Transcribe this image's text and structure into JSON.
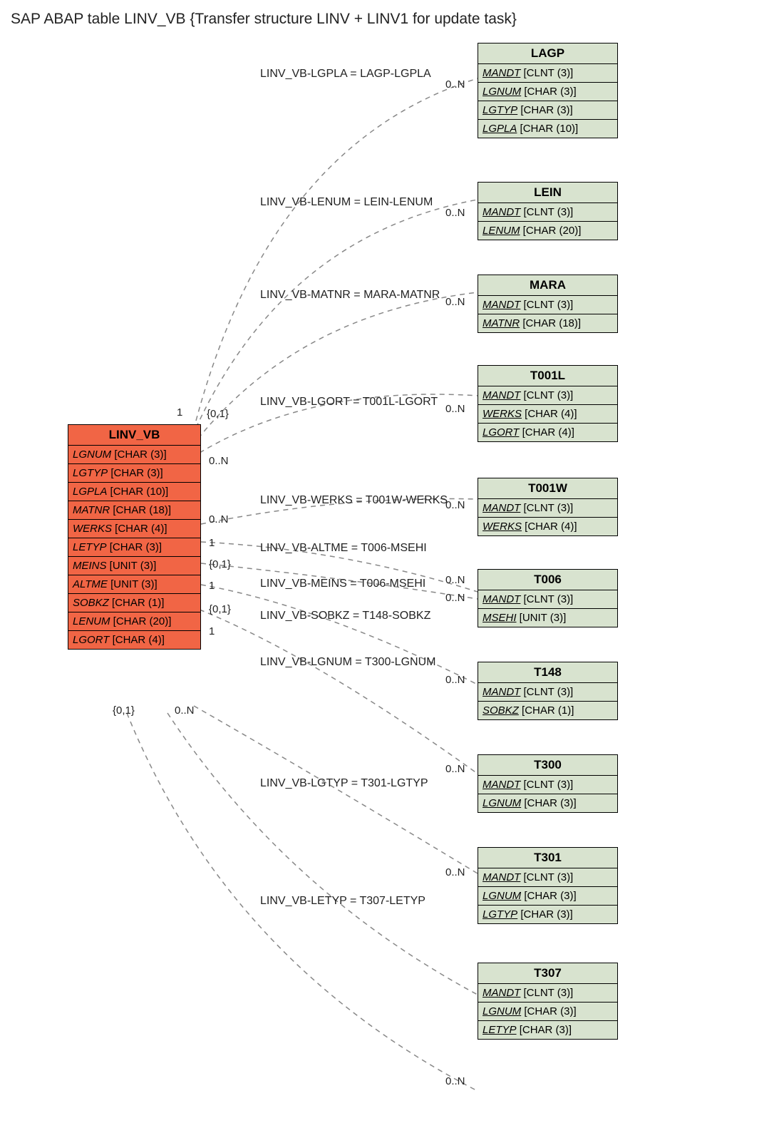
{
  "title": "SAP ABAP table LINV_VB {Transfer structure LINV + LINV1 for update task}",
  "mainEntity": {
    "name": "LINV_VB",
    "fields": [
      {
        "name": "LGNUM",
        "type": "[CHAR (3)]"
      },
      {
        "name": "LGTYP",
        "type": "[CHAR (3)]"
      },
      {
        "name": "LGPLA",
        "type": "[CHAR (10)]"
      },
      {
        "name": "MATNR",
        "type": "[CHAR (18)]"
      },
      {
        "name": "WERKS",
        "type": "[CHAR (4)]"
      },
      {
        "name": "LETYP",
        "type": "[CHAR (3)]"
      },
      {
        "name": "MEINS",
        "type": "[UNIT (3)]"
      },
      {
        "name": "ALTME",
        "type": "[UNIT (3)]"
      },
      {
        "name": "SOBKZ",
        "type": "[CHAR (1)]"
      },
      {
        "name": "LENUM",
        "type": "[CHAR (20)]"
      },
      {
        "name": "LGORT",
        "type": "[CHAR (4)]"
      }
    ]
  },
  "relatedEntities": [
    {
      "name": "LAGP",
      "fields": [
        {
          "name": "MANDT",
          "type": "[CLNT (3)]"
        },
        {
          "name": "LGNUM",
          "type": "[CHAR (3)]"
        },
        {
          "name": "LGTYP",
          "type": "[CHAR (3)]"
        },
        {
          "name": "LGPLA",
          "type": "[CHAR (10)]"
        }
      ]
    },
    {
      "name": "LEIN",
      "fields": [
        {
          "name": "MANDT",
          "type": "[CLNT (3)]"
        },
        {
          "name": "LENUM",
          "type": "[CHAR (20)]"
        }
      ]
    },
    {
      "name": "MARA",
      "fields": [
        {
          "name": "MANDT",
          "type": "[CLNT (3)]"
        },
        {
          "name": "MATNR",
          "type": "[CHAR (18)]"
        }
      ]
    },
    {
      "name": "T001L",
      "fields": [
        {
          "name": "MANDT",
          "type": "[CLNT (3)]"
        },
        {
          "name": "WERKS",
          "type": "[CHAR (4)]"
        },
        {
          "name": "LGORT",
          "type": "[CHAR (4)]"
        }
      ]
    },
    {
      "name": "T001W",
      "fields": [
        {
          "name": "MANDT",
          "type": "[CLNT (3)]"
        },
        {
          "name": "WERKS",
          "type": "[CHAR (4)]"
        }
      ]
    },
    {
      "name": "T006",
      "fields": [
        {
          "name": "MANDT",
          "type": "[CLNT (3)]"
        },
        {
          "name": "MSEHI",
          "type": "[UNIT (3)]"
        }
      ]
    },
    {
      "name": "T148",
      "fields": [
        {
          "name": "MANDT",
          "type": "[CLNT (3)]"
        },
        {
          "name": "SOBKZ",
          "type": "[CHAR (1)]"
        }
      ]
    },
    {
      "name": "T300",
      "fields": [
        {
          "name": "MANDT",
          "type": "[CLNT (3)]"
        },
        {
          "name": "LGNUM",
          "type": "[CHAR (3)]"
        }
      ]
    },
    {
      "name": "T301",
      "fields": [
        {
          "name": "MANDT",
          "type": "[CLNT (3)]"
        },
        {
          "name": "LGNUM",
          "type": "[CHAR (3)]"
        },
        {
          "name": "LGTYP",
          "type": "[CHAR (3)]"
        }
      ]
    },
    {
      "name": "T307",
      "fields": [
        {
          "name": "MANDT",
          "type": "[CLNT (3)]"
        },
        {
          "name": "LGNUM",
          "type": "[CHAR (3)]"
        },
        {
          "name": "LETYP",
          "type": "[CHAR (3)]"
        }
      ]
    }
  ],
  "relationLabels": [
    "LINV_VB-LGPLA = LAGP-LGPLA",
    "LINV_VB-LENUM = LEIN-LENUM",
    "LINV_VB-MATNR = MARA-MATNR",
    "LINV_VB-LGORT = T001L-LGORT",
    "LINV_VB-WERKS = T001W-WERKS",
    "LINV_VB-ALTME = T006-MSEHI",
    "LINV_VB-MEINS = T006-MSEHI",
    "LINV_VB-SOBKZ = T148-SOBKZ",
    "LINV_VB-LGNUM = T300-LGNUM",
    "LINV_VB-LGTYP = T301-LGTYP",
    "LINV_VB-LETYP = T307-LETYP"
  ],
  "leftCards": [
    "1",
    "{0,1}",
    "0..N",
    "0..N",
    "1",
    "{0,1}",
    "1",
    "{0,1}",
    "1",
    "{0,1}",
    "0..N"
  ],
  "rightCards": [
    "0..N",
    "0..N",
    "0..N",
    "0..N",
    "0..N",
    "0..N",
    "0..N",
    "0..N",
    "0..N",
    "0..N",
    "0..N"
  ]
}
